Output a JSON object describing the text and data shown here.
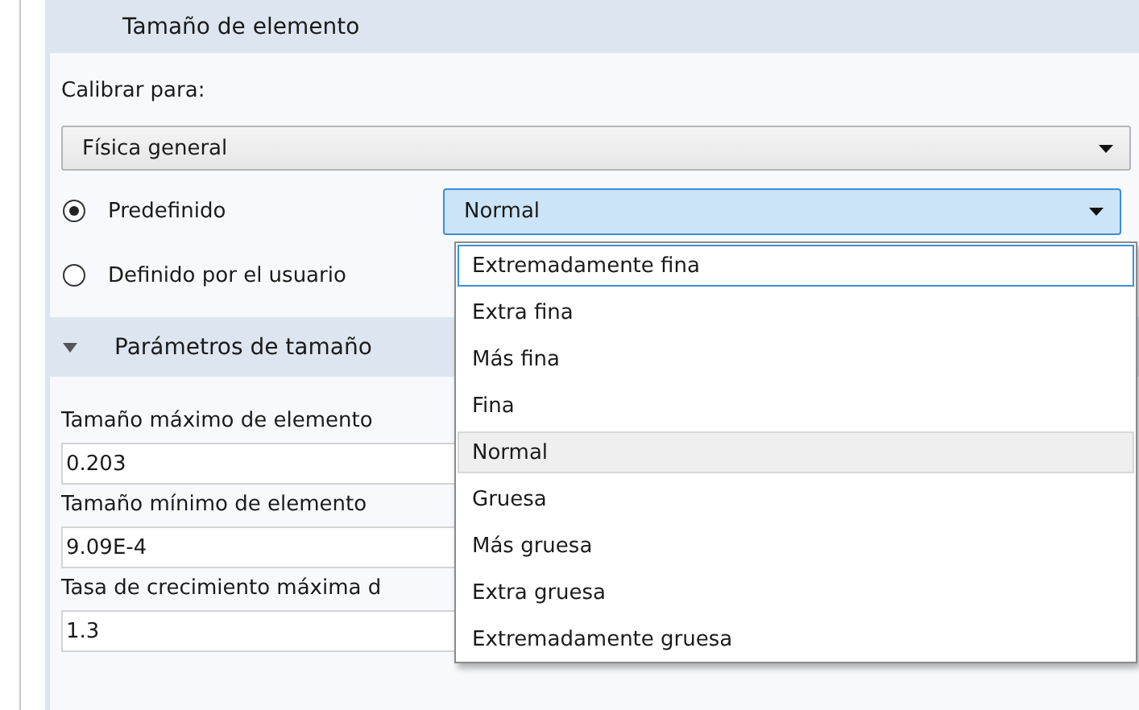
{
  "section": {
    "title": "Tamaño de elemento"
  },
  "calibrate": {
    "label": "Calibrar para:",
    "value": "Física general"
  },
  "radios": [
    {
      "label": "Predefinido",
      "selected": true
    },
    {
      "label": "Definido por el usuario",
      "selected": false
    }
  ],
  "preset_select": {
    "value": "Normal",
    "open": true
  },
  "dropdown": {
    "items": [
      {
        "label": "Extremadamente fina",
        "selected": false,
        "focused": true
      },
      {
        "label": "Extra fina",
        "selected": false,
        "focused": false
      },
      {
        "label": "Más fina",
        "selected": false,
        "focused": false
      },
      {
        "label": "Fina",
        "selected": false,
        "focused": false
      },
      {
        "label": "Normal",
        "selected": true,
        "focused": false
      },
      {
        "label": "Gruesa",
        "selected": false,
        "focused": false
      },
      {
        "label": "Más gruesa",
        "selected": false,
        "focused": false
      },
      {
        "label": "Extra gruesa",
        "selected": false,
        "focused": false
      },
      {
        "label": "Extremadamente gruesa",
        "selected": false,
        "focused": false
      }
    ]
  },
  "subsection": {
    "title": "Parámetros de tamaño",
    "expanded": true
  },
  "fields": [
    {
      "label": "Tamaño máximo de elemento",
      "value": "0.203"
    },
    {
      "label": "Tamaño mínimo de elemento",
      "value": "9.09E-4"
    },
    {
      "label": "Tasa de crecimiento máxima d",
      "value": "1.3"
    }
  ]
}
